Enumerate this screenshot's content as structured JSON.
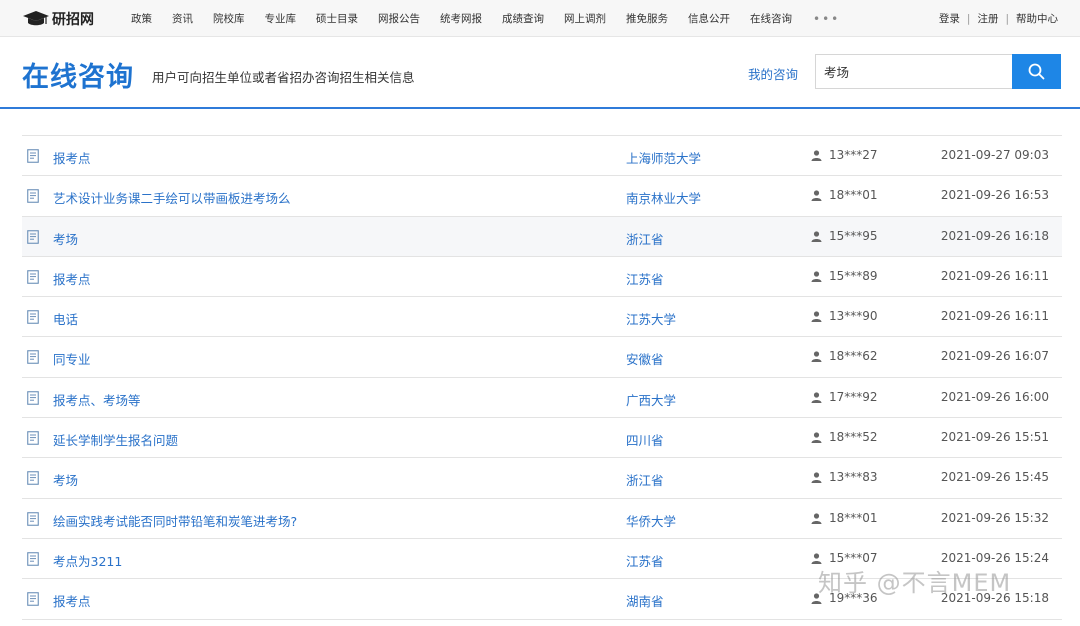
{
  "site": {
    "name": "研招网"
  },
  "nav": {
    "items": [
      "政策",
      "资讯",
      "院校库",
      "专业库",
      "硕士目录",
      "网报公告",
      "统考网报",
      "成绩查询",
      "网上调剂",
      "推免服务",
      "信息公开",
      "在线咨询"
    ],
    "more": "•••"
  },
  "user_links": {
    "login": "登录",
    "register": "注册",
    "help": "帮助中心",
    "sep": "|"
  },
  "header": {
    "title": "在线咨询",
    "subtitle": "用户可向招生单位或者省招办咨询招生相关信息",
    "my_consult": "我的咨询",
    "search_value": "考场"
  },
  "rows": [
    {
      "title": "报考点",
      "org": "上海师范大学",
      "user": "13***27",
      "time": "2021-09-27 09:03"
    },
    {
      "title": "艺术设计业务课二手绘可以带画板进考场么",
      "org": "南京林业大学",
      "user": "18***01",
      "time": "2021-09-26 16:53"
    },
    {
      "title": "考场",
      "org": "浙江省",
      "user": "15***95",
      "time": "2021-09-26 16:18"
    },
    {
      "title": "报考点",
      "org": "江苏省",
      "user": "15***89",
      "time": "2021-09-26 16:11"
    },
    {
      "title": "电话",
      "org": "江苏大学",
      "user": "13***90",
      "time": "2021-09-26 16:11"
    },
    {
      "title": "同专业",
      "org": "安徽省",
      "user": "18***62",
      "time": "2021-09-26 16:07"
    },
    {
      "title": "报考点、考场等",
      "org": "广西大学",
      "user": "17***92",
      "time": "2021-09-26 16:00"
    },
    {
      "title": "延长学制学生报名问题",
      "org": "四川省",
      "user": "18***52",
      "time": "2021-09-26 15:51"
    },
    {
      "title": "考场",
      "org": "浙江省",
      "user": "13***83",
      "time": "2021-09-26 15:45"
    },
    {
      "title": "绘画实践考试能否同时带铅笔和炭笔进考场?",
      "org": "华侨大学",
      "user": "18***01",
      "time": "2021-09-26 15:32"
    },
    {
      "title": "考点为3211",
      "org": "江苏省",
      "user": "15***07",
      "time": "2021-09-26 15:24"
    },
    {
      "title": "报考点",
      "org": "湖南省",
      "user": "19***36",
      "time": "2021-09-26 15:18"
    }
  ],
  "highlighted_row": 2,
  "watermark": "知乎 @不言MEM",
  "colors": {
    "accent": "#1e73d0",
    "link": "#2a72c9",
    "search_button": "#1e86e6"
  }
}
